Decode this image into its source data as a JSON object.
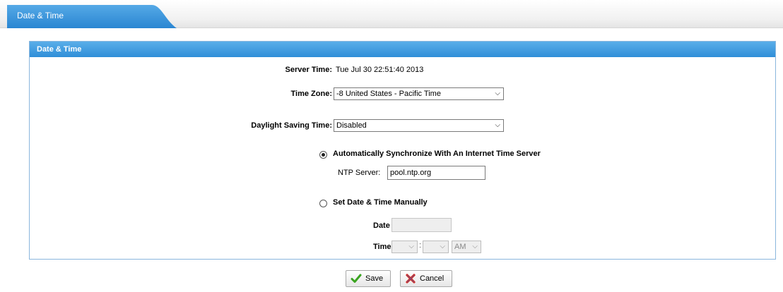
{
  "tab": {
    "label": "Date & Time",
    "color": "#2f8ed8"
  },
  "panel": {
    "title": "Date & Time"
  },
  "server_time": {
    "label": "Server Time:",
    "value": "Tue Jul 30 22:51:40 2013"
  },
  "time_zone": {
    "label": "Time Zone:",
    "selected": "-8 United States - Pacific Time"
  },
  "dst": {
    "label": "Daylight Saving Time:",
    "selected": "Disabled"
  },
  "auto_sync": {
    "label": "Automatically Synchronize With An Internet Time Server",
    "checked": true,
    "ntp_label": "NTP Server:",
    "ntp_value": "pool.ntp.org"
  },
  "manual": {
    "label": "Set Date & Time Manually",
    "checked": false,
    "date_label": "Date",
    "time_label": "Time",
    "time_separator": ":",
    "ampm_selected": "AM"
  },
  "buttons": {
    "save": "Save",
    "cancel": "Cancel"
  },
  "icons": {
    "save": "check-icon",
    "cancel": "x-icon",
    "dropdown": "chevron-down-icon"
  },
  "colors": {
    "accent": "#2f8ed8",
    "panel_border": "#8ab6dd",
    "save_icon": "#3aa420",
    "cancel_icon": "#d8281c"
  }
}
